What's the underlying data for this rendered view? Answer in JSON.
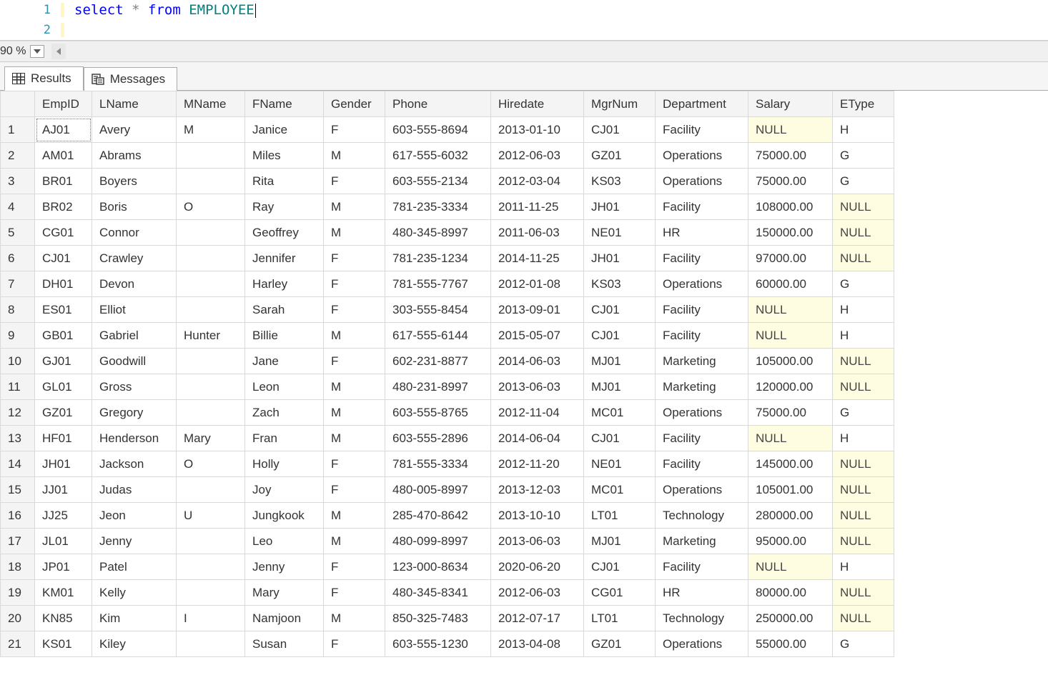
{
  "editor": {
    "lines": [
      {
        "num": "1",
        "tokens": [
          {
            "t": "select",
            "c": "kw"
          },
          {
            "t": " ",
            "c": ""
          },
          {
            "t": "*",
            "c": "op"
          },
          {
            "t": " ",
            "c": ""
          },
          {
            "t": "from",
            "c": "kw"
          },
          {
            "t": " ",
            "c": ""
          },
          {
            "t": "EMPLOYEE",
            "c": "ident"
          }
        ]
      },
      {
        "num": "2",
        "tokens": []
      }
    ]
  },
  "zoom": {
    "label": "90 %"
  },
  "tabs": {
    "results_label": "Results",
    "messages_label": "Messages"
  },
  "columns": [
    "EmpID",
    "LName",
    "MName",
    "FName",
    "Gender",
    "Phone",
    "Hiredate",
    "MgrNum",
    "Department",
    "Salary",
    "EType"
  ],
  "null_text": "NULL",
  "rows": [
    {
      "EmpID": "AJ01",
      "LName": "Avery",
      "MName": "M",
      "FName": "Janice",
      "Gender": "F",
      "Phone": "603-555-8694",
      "Hiredate": "2013-01-10",
      "MgrNum": "CJ01",
      "Department": "Facility",
      "Salary": null,
      "EType": "H"
    },
    {
      "EmpID": "AM01",
      "LName": "Abrams",
      "MName": "",
      "FName": "Miles",
      "Gender": "M",
      "Phone": "617-555-6032",
      "Hiredate": "2012-06-03",
      "MgrNum": "GZ01",
      "Department": "Operations",
      "Salary": "75000.00",
      "EType": "G"
    },
    {
      "EmpID": "BR01",
      "LName": "Boyers",
      "MName": "",
      "FName": "Rita",
      "Gender": "F",
      "Phone": "603-555-2134",
      "Hiredate": "2012-03-04",
      "MgrNum": "KS03",
      "Department": "Operations",
      "Salary": "75000.00",
      "EType": "G"
    },
    {
      "EmpID": "BR02",
      "LName": "Boris",
      "MName": "O",
      "FName": "Ray",
      "Gender": "M",
      "Phone": "781-235-3334",
      "Hiredate": "2011-11-25",
      "MgrNum": "JH01",
      "Department": "Facility",
      "Salary": "108000.00",
      "EType": null
    },
    {
      "EmpID": "CG01",
      "LName": "Connor",
      "MName": "",
      "FName": "Geoffrey",
      "Gender": "M",
      "Phone": "480-345-8997",
      "Hiredate": "2011-06-03",
      "MgrNum": "NE01",
      "Department": "HR",
      "Salary": "150000.00",
      "EType": null
    },
    {
      "EmpID": "CJ01",
      "LName": "Crawley",
      "MName": "",
      "FName": "Jennifer",
      "Gender": "F",
      "Phone": "781-235-1234",
      "Hiredate": "2014-11-25",
      "MgrNum": "JH01",
      "Department": "Facility",
      "Salary": "97000.00",
      "EType": null
    },
    {
      "EmpID": "DH01",
      "LName": "Devon",
      "MName": "",
      "FName": "Harley",
      "Gender": "F",
      "Phone": "781-555-7767",
      "Hiredate": "2012-01-08",
      "MgrNum": "KS03",
      "Department": "Operations",
      "Salary": "60000.00",
      "EType": "G"
    },
    {
      "EmpID": "ES01",
      "LName": "Elliot",
      "MName": "",
      "FName": "Sarah",
      "Gender": "F",
      "Phone": "303-555-8454",
      "Hiredate": "2013-09-01",
      "MgrNum": "CJ01",
      "Department": "Facility",
      "Salary": null,
      "EType": "H"
    },
    {
      "EmpID": "GB01",
      "LName": "Gabriel",
      "MName": "Hunter",
      "FName": "Billie",
      "Gender": "M",
      "Phone": "617-555-6144",
      "Hiredate": "2015-05-07",
      "MgrNum": "CJ01",
      "Department": "Facility",
      "Salary": null,
      "EType": "H"
    },
    {
      "EmpID": "GJ01",
      "LName": "Goodwill",
      "MName": "",
      "FName": "Jane",
      "Gender": "F",
      "Phone": "602-231-8877",
      "Hiredate": "2014-06-03",
      "MgrNum": "MJ01",
      "Department": "Marketing",
      "Salary": "105000.00",
      "EType": null
    },
    {
      "EmpID": "GL01",
      "LName": "Gross",
      "MName": "",
      "FName": "Leon",
      "Gender": "M",
      "Phone": "480-231-8997",
      "Hiredate": "2013-06-03",
      "MgrNum": "MJ01",
      "Department": "Marketing",
      "Salary": "120000.00",
      "EType": null
    },
    {
      "EmpID": "GZ01",
      "LName": "Gregory",
      "MName": "",
      "FName": "Zach",
      "Gender": "M",
      "Phone": "603-555-8765",
      "Hiredate": "2012-11-04",
      "MgrNum": "MC01",
      "Department": "Operations",
      "Salary": "75000.00",
      "EType": "G"
    },
    {
      "EmpID": "HF01",
      "LName": "Henderson",
      "MName": "Mary",
      "FName": "Fran",
      "Gender": "M",
      "Phone": "603-555-2896",
      "Hiredate": "2014-06-04",
      "MgrNum": "CJ01",
      "Department": "Facility",
      "Salary": null,
      "EType": "H"
    },
    {
      "EmpID": "JH01",
      "LName": "Jackson",
      "MName": "O",
      "FName": "Holly",
      "Gender": "F",
      "Phone": "781-555-3334",
      "Hiredate": "2012-11-20",
      "MgrNum": "NE01",
      "Department": "Facility",
      "Salary": "145000.00",
      "EType": null
    },
    {
      "EmpID": "JJ01",
      "LName": "Judas",
      "MName": "",
      "FName": "Joy",
      "Gender": "F",
      "Phone": "480-005-8997",
      "Hiredate": "2013-12-03",
      "MgrNum": "MC01",
      "Department": "Operations",
      "Salary": "105001.00",
      "EType": null
    },
    {
      "EmpID": "JJ25",
      "LName": "Jeon",
      "MName": "U",
      "FName": "Jungkook",
      "Gender": "M",
      "Phone": "285-470-8642",
      "Hiredate": "2013-10-10",
      "MgrNum": "LT01",
      "Department": "Technology",
      "Salary": "280000.00",
      "EType": null
    },
    {
      "EmpID": "JL01",
      "LName": "Jenny",
      "MName": "",
      "FName": "Leo",
      "Gender": "M",
      "Phone": "480-099-8997",
      "Hiredate": "2013-06-03",
      "MgrNum": "MJ01",
      "Department": "Marketing",
      "Salary": "95000.00",
      "EType": null
    },
    {
      "EmpID": "JP01",
      "LName": "Patel",
      "MName": "",
      "FName": "Jenny",
      "Gender": "F",
      "Phone": "123-000-8634",
      "Hiredate": "2020-06-20",
      "MgrNum": "CJ01",
      "Department": "Facility",
      "Salary": null,
      "EType": "H"
    },
    {
      "EmpID": "KM01",
      "LName": "Kelly",
      "MName": "",
      "FName": "Mary",
      "Gender": "F",
      "Phone": "480-345-8341",
      "Hiredate": "2012-06-03",
      "MgrNum": "CG01",
      "Department": "HR",
      "Salary": "80000.00",
      "EType": null
    },
    {
      "EmpID": "KN85",
      "LName": "Kim",
      "MName": "I",
      "FName": "Namjoon",
      "Gender": "M",
      "Phone": "850-325-7483",
      "Hiredate": "2012-07-17",
      "MgrNum": "LT01",
      "Department": "Technology",
      "Salary": "250000.00",
      "EType": null
    },
    {
      "EmpID": "KS01",
      "LName": "Kiley",
      "MName": "",
      "FName": "Susan",
      "Gender": "F",
      "Phone": "603-555-1230",
      "Hiredate": "2013-04-08",
      "MgrNum": "GZ01",
      "Department": "Operations",
      "Salary": "55000.00",
      "EType": "G"
    }
  ]
}
